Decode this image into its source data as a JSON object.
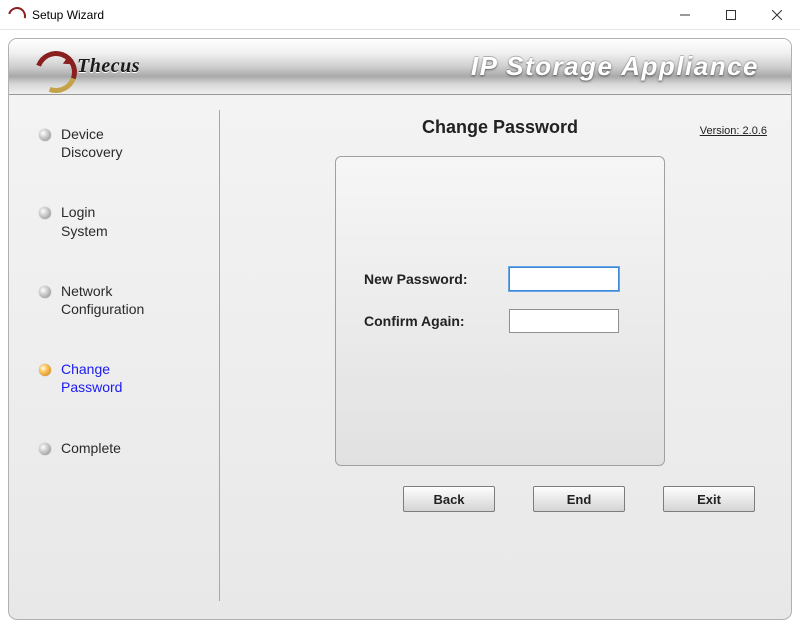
{
  "window": {
    "title": "Setup Wizard"
  },
  "brand": {
    "logo_text": "Thecus",
    "product_title": "IP Storage Appliance"
  },
  "version_label": "Version: 2.0.6",
  "sidebar": {
    "steps": [
      {
        "label": "Device\nDiscovery",
        "active": false
      },
      {
        "label": "Login\nSystem",
        "active": false
      },
      {
        "label": "Network\nConfiguration",
        "active": false
      },
      {
        "label": "Change\nPassword",
        "active": true
      },
      {
        "label": "Complete",
        "active": false
      }
    ]
  },
  "page": {
    "title": "Change Password",
    "fields": {
      "new_password": {
        "label": "New Password:",
        "value": ""
      },
      "confirm": {
        "label": "Confirm Again:",
        "value": ""
      }
    }
  },
  "buttons": {
    "back": "Back",
    "end": "End",
    "exit": "Exit"
  }
}
